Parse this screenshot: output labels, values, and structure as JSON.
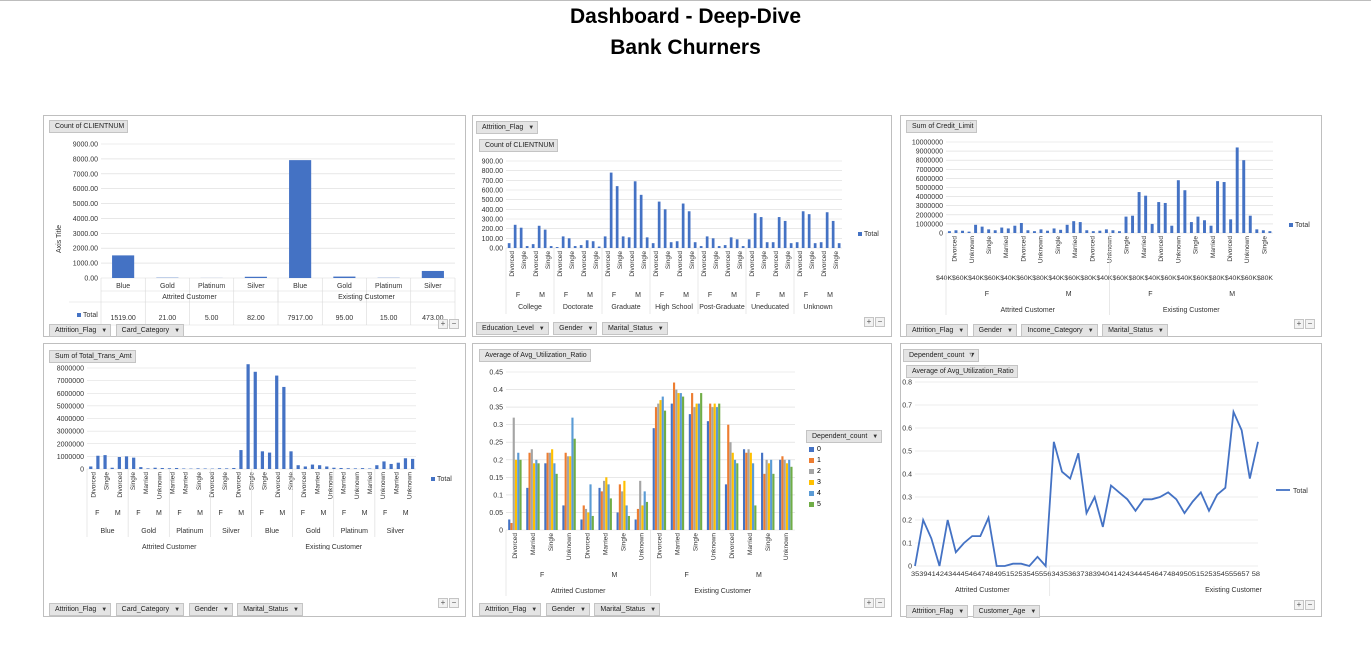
{
  "title_line1": "Dashboard - Deep-Dive",
  "title_line2": "Bank Churners",
  "colors": {
    "blue": "#4472c4",
    "orange": "#ed7d31",
    "gray": "#a5a5a5",
    "yellow": "#ffc000",
    "lightblue": "#5b9bd5",
    "green": "#70ad47"
  },
  "chart_data": [
    {
      "type": "bar",
      "title": "Count of CLIENTNUM",
      "ylabel": "Axis Title",
      "ylim": [
        0,
        9000
      ],
      "yticks": [
        "9000.00",
        "8000.00",
        "7000.00",
        "6000.00",
        "5000.00",
        "4000.00",
        "3000.00",
        "2000.00",
        "1000.00",
        "0.00"
      ],
      "groups": [
        {
          "label": "Attrited Customer",
          "categories": [
            "Blue",
            "Gold",
            "Platinum",
            "Silver"
          ],
          "values": [
            1519,
            21,
            5,
            82
          ],
          "display": [
            "1519.00",
            "21.00",
            "5.00",
            "82.00"
          ]
        },
        {
          "label": "Existing Customer",
          "categories": [
            "Blue",
            "Gold",
            "Platinum",
            "Silver"
          ],
          "values": [
            7917,
            95,
            15,
            473
          ],
          "display": [
            "7917.00",
            "95.00",
            "15.00",
            "473.00"
          ]
        }
      ],
      "table_label": "Total",
      "filters": [
        "Attrition_Flag",
        "Card_Category"
      ]
    },
    {
      "type": "bar",
      "title": "Count of CLIENTNUM",
      "page_filter": "Attrition_Flag",
      "ylim": [
        0,
        900
      ],
      "yticks": [
        "900.00",
        "800.00",
        "700.00",
        "600.00",
        "500.00",
        "400.00",
        "300.00",
        "200.00",
        "100.00",
        "0.00"
      ],
      "bar_labels": [
        "Divorced",
        "Single",
        "Divorced",
        "Single",
        "Divorced",
        "Single",
        "Divorced",
        "Single",
        "Divorced",
        "Single",
        "Divorced",
        "Single",
        "Divorced",
        "Single",
        "Divorced",
        "Single",
        "Divorced",
        "Single",
        "Divorced",
        "Single",
        "Divorced",
        "Single",
        "Divorced",
        "Single",
        "Divorced",
        "Single",
        "Divorced",
        "Single"
      ],
      "gender_labels": [
        "F",
        "M",
        "F",
        "M",
        "F",
        "M",
        "F",
        "M",
        "F",
        "M",
        "F",
        "M",
        "F",
        "M"
      ],
      "education": [
        "College",
        "Doctorate",
        "Graduate",
        "High School",
        "Post-Graduate",
        "Uneducated",
        "Unknown"
      ],
      "values": [
        50,
        240,
        210,
        20,
        40,
        230,
        190,
        20,
        10,
        120,
        100,
        20,
        30,
        80,
        70,
        15,
        120,
        780,
        640,
        120,
        110,
        690,
        550,
        110,
        50,
        480,
        400,
        60,
        70,
        460,
        380,
        60,
        20,
        120,
        100,
        20,
        30,
        110,
        90,
        20,
        90,
        360,
        320,
        60,
        60,
        320,
        280,
        50,
        60,
        380,
        350,
        50,
        60,
        370,
        280,
        50
      ],
      "legend": "Total",
      "filters": [
        "Education_Level",
        "Gender",
        "Marital_Status"
      ]
    },
    {
      "type": "bar",
      "title": "Sum of Credit_Limit",
      "ylim": [
        0,
        10000000
      ],
      "yticks": [
        "10000000",
        "9000000",
        "8000000",
        "7000000",
        "6000000",
        "5000000",
        "4000000",
        "3000000",
        "2000000",
        "1000000",
        "0"
      ],
      "bar_labels": [
        "Divorced",
        "Unknown",
        "Single",
        "Married",
        "Divorced",
        "Unknown",
        "Single",
        "Married",
        "Divorced",
        "Unknown",
        "Single",
        "Married",
        "Divorced",
        "Unknown",
        "Single",
        "Married",
        "Divorced",
        "Unknown",
        "Single"
      ],
      "income_labels": "$40K$60K$40K$60K$40K$60K$80K$40K$60K$80K$40K$60K$80K$40K$60K$40K$60K$80K$40K$60K$80K",
      "gender_labels": [
        "F",
        "M",
        "F",
        "M"
      ],
      "groups": [
        "Attrited Customer",
        "Existing Customer"
      ],
      "values": [
        200000,
        300000,
        250000,
        150000,
        900000,
        700000,
        400000,
        300000,
        600000,
        500000,
        800000,
        1100000,
        300000,
        200000,
        400000,
        250000,
        500000,
        350000,
        900000,
        1300000,
        1200000,
        300000,
        200000,
        250000,
        400000,
        300000,
        200000,
        1800000,
        1900000,
        4500000,
        4100000,
        1000000,
        3400000,
        3300000,
        800000,
        5800000,
        4700000,
        1200000,
        1800000,
        1400000,
        800000,
        5700000,
        5600000,
        1500000,
        9400000,
        8000000,
        1900000,
        400000,
        300000,
        200000
      ],
      "legend": "Total",
      "filters": [
        "Attrition_Flag",
        "Gender",
        "Income_Category",
        "Marital_Status"
      ]
    },
    {
      "type": "bar",
      "title": "Sum of Total_Trans_Amt",
      "ylim": [
        0,
        8000000
      ],
      "yticks": [
        "8000000",
        "7000000",
        "6000000",
        "5000000",
        "4000000",
        "3000000",
        "2000000",
        "1000000",
        "0"
      ],
      "bar_labels": [
        "Divorced",
        "Single",
        "Divorced",
        "Single",
        "Married",
        "Unknown",
        "Married",
        "Married",
        "Single",
        "Divorced",
        "Single",
        "Divorced",
        "Single",
        "Single",
        "Divorced",
        "Single",
        "Divorced",
        "Married",
        "Unknown",
        "Married",
        "Unknown",
        "Married",
        "Unknown",
        "Married",
        "Unknown"
      ],
      "gender_labels": [
        "F",
        "M",
        "F",
        "M",
        "F",
        "M",
        "F",
        "M",
        "F",
        "M",
        "F",
        "M",
        "F",
        "M",
        "F",
        "M"
      ],
      "card_labels": [
        "Blue",
        "Gold",
        "Platinum",
        "Silver",
        "Blue",
        "Gold",
        "Platinum",
        "Silver"
      ],
      "groups": [
        "Attrited Customer",
        "Existing Customer"
      ],
      "values": [
        200000,
        1050000,
        1100000,
        100000,
        950000,
        1000000,
        900000,
        150000,
        50000,
        100000,
        80000,
        60000,
        80000,
        40000,
        30000,
        50000,
        40000,
        30000,
        60000,
        50000,
        80000,
        1500000,
        8300000,
        7700000,
        1400000,
        1300000,
        7400000,
        6500000,
        1400000,
        300000,
        200000,
        350000,
        300000,
        200000,
        100000,
        80000,
        60000,
        50000,
        70000,
        40000,
        300000,
        600000,
        400000,
        500000,
        850000,
        800000
      ],
      "legend": "Total",
      "filters": [
        "Attrition_Flag",
        "Card_Category",
        "Gender",
        "Marital_Status"
      ]
    },
    {
      "type": "bar",
      "title": "Average of Avg_Utilization_Ratio",
      "ylim": [
        0,
        0.45
      ],
      "yticks": [
        "0.45",
        "0.4",
        "0.35",
        "0.3",
        "0.25",
        "0.2",
        "0.15",
        "0.1",
        "0.05",
        "0"
      ],
      "bar_labels": [
        "Divorced",
        "Married",
        "Single",
        "Unknown",
        "Divorced",
        "Married",
        "Single",
        "Unknown",
        "Divorced",
        "Married",
        "Single",
        "Unknown",
        "Divorced",
        "Married",
        "Single",
        "Unknown"
      ],
      "gender_labels": [
        "F",
        "M",
        "F",
        "M"
      ],
      "groups": [
        "Attrited Customer",
        "Existing Customer"
      ],
      "legend_title": "Dependent_count",
      "series_names": [
        "0",
        "1",
        "2",
        "3",
        "4",
        "5"
      ],
      "series": [
        [
          0.03,
          0.12,
          0.19,
          0.07,
          0.03,
          0.12,
          0.05,
          0.03,
          0.29,
          0.36,
          0.33,
          0.31,
          0.13,
          0.23,
          0.22,
          0.2
        ],
        [
          0.02,
          0.22,
          0.22,
          0.22,
          0.07,
          0.11,
          0.13,
          0.06,
          0.35,
          0.42,
          0.39,
          0.36,
          0.3,
          0.22,
          0.16,
          0.21
        ],
        [
          0.32,
          0.23,
          0.22,
          0.21,
          0.06,
          0.14,
          0.11,
          0.14,
          0.36,
          0.4,
          0.35,
          0.35,
          0.25,
          0.23,
          0.2,
          0.2
        ],
        [
          0.2,
          0.19,
          0.23,
          0.21,
          0.05,
          0.15,
          0.14,
          0.07,
          0.37,
          0.39,
          0.36,
          0.36,
          0.22,
          0.22,
          0.19,
          0.19
        ],
        [
          0.22,
          0.2,
          0.19,
          0.32,
          0.13,
          0.13,
          0.07,
          0.11,
          0.38,
          0.39,
          0.36,
          0.35,
          0.2,
          0.19,
          0.2,
          0.2
        ],
        [
          0.2,
          0.19,
          0.16,
          0.26,
          0.04,
          0.09,
          0.04,
          0.08,
          0.34,
          0.38,
          0.39,
          0.36,
          0.19,
          0.07,
          0.16,
          0.18
        ]
      ],
      "filters": [
        "Attrition_Flag",
        "Gender",
        "Marital_Status"
      ]
    },
    {
      "type": "line",
      "title": "Average of Avg_Utilization_Ratio",
      "page_filter": "Dependent_count",
      "ylim": [
        0,
        0.8
      ],
      "yticks": [
        "0.8",
        "0.7",
        "0.6",
        "0.5",
        "0.4",
        "0.3",
        "0.2",
        "0.1",
        "0"
      ],
      "x_label_string": "3539414243444546474849515253545556343536373839404142434445464748495051525354555657 58",
      "groups": [
        "Attrited Customer",
        "Existing Customer"
      ],
      "values": [
        0.0,
        0.2,
        0.12,
        0.0,
        0.2,
        0.06,
        0.1,
        0.13,
        0.13,
        0.21,
        0.0,
        0.0,
        0.01,
        0.01,
        0.0,
        0.04,
        0.0,
        0.54,
        0.41,
        0.38,
        0.49,
        0.23,
        0.3,
        0.17,
        0.35,
        0.32,
        0.29,
        0.24,
        0.29,
        0.29,
        0.3,
        0.32,
        0.29,
        0.23,
        0.28,
        0.32,
        0.24,
        0.31,
        0.34,
        0.67,
        0.59,
        0.38,
        0.54
      ],
      "legend": "Total",
      "filters": [
        "Attrition_Flag",
        "Customer_Age"
      ]
    }
  ]
}
